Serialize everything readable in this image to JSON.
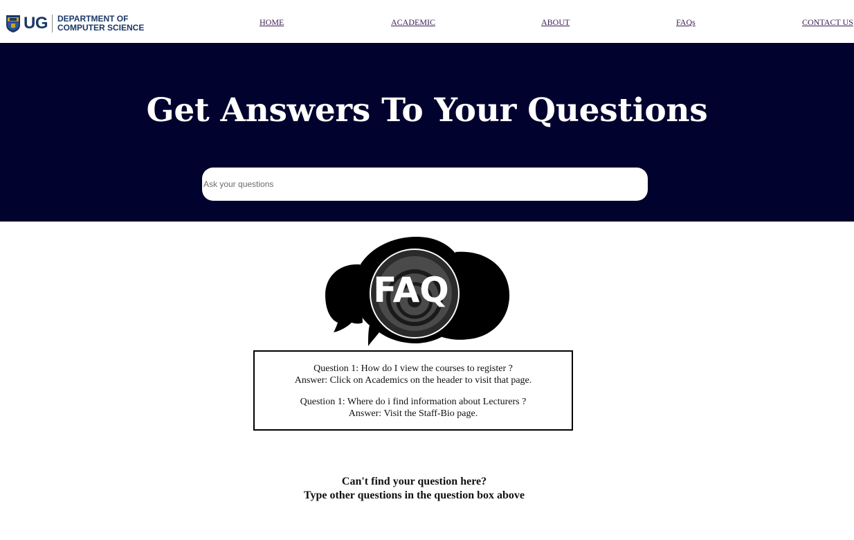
{
  "header": {
    "logo_text": "UG",
    "dept_line1": "DEPARTMENT OF",
    "dept_line2": "COMPUTER SCIENCE",
    "nav": {
      "home": "HOME",
      "academic": "ACADEMIC",
      "about": "ABOUT",
      "faqs": "FAQs",
      "contact": "CONTACT US"
    }
  },
  "hero": {
    "title": "Get Answers To Your Questions",
    "search_placeholder": "Ask your questions"
  },
  "faq_graphic": {
    "label": "FAQ",
    "icon": "speech-bubbles-faq-icon"
  },
  "faqs": [
    {
      "question": "Question 1: How do I view the courses to register ?",
      "answer": "Answer: Click on Academics on the header to visit that page."
    },
    {
      "question": "Question 1: Where do i find information about Lecturers ?",
      "answer": "Answer: Visit the Staff-Bio page."
    }
  ],
  "footer_note": {
    "line1": "Can't find your question here?",
    "line2": "Type other questions in the question box above"
  },
  "colors": {
    "hero_bg": "#02022f",
    "logo_blue": "#1c3766",
    "nav_link": "#3c1d52"
  }
}
